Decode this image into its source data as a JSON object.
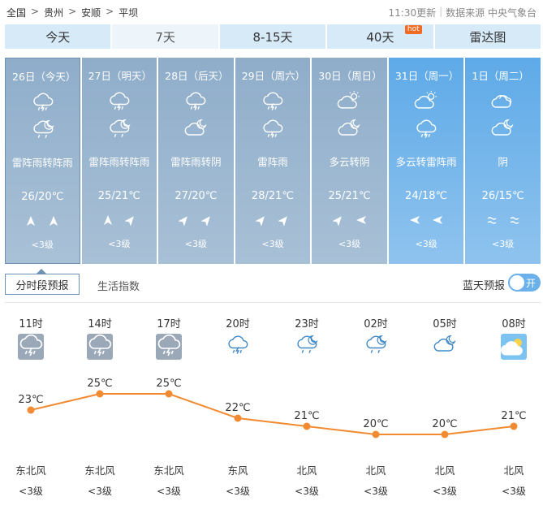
{
  "breadcrumb": [
    "全国",
    "贵州",
    "安顺",
    "平坝"
  ],
  "breadcrumb_sep": ">",
  "meta": {
    "updated": "11:30更新",
    "source": "数据来源 中央气象台"
  },
  "tabs": [
    {
      "label": "今天"
    },
    {
      "label": "7天",
      "active": true
    },
    {
      "label": "8-15天"
    },
    {
      "label": "40天",
      "badge": "hot"
    },
    {
      "label": "雷达图"
    }
  ],
  "days": [
    {
      "date": "26日（今天）",
      "icons": [
        "thunder-shower-icon",
        "shower-night-icon"
      ],
      "cond": "雷阵雨转阵雨",
      "temp": "26/20℃",
      "winds": [
        "north",
        "north"
      ],
      "level": "<3级",
      "style": "today"
    },
    {
      "date": "27日（明天）",
      "icons": [
        "thunder-shower-icon",
        "shower-night-icon"
      ],
      "cond": "雷阵雨转阵雨",
      "temp": "25/21℃",
      "winds": [
        "north",
        "northeast"
      ],
      "level": "<3级",
      "style": "past"
    },
    {
      "date": "28日（后天）",
      "icons": [
        "thunder-shower-icon",
        "cloudy-night-icon"
      ],
      "cond": "雷阵雨转阴",
      "temp": "27/20℃",
      "winds": [
        "northeast",
        "northeast"
      ],
      "level": "<3级",
      "style": "past"
    },
    {
      "date": "29日（周六）",
      "icons": [
        "thunder-shower-icon",
        "thunder-shower-icon"
      ],
      "cond": "雷阵雨",
      "temp": "28/21℃",
      "winds": [
        "northeast",
        "northeast"
      ],
      "level": "<3级",
      "style": "past"
    },
    {
      "date": "30日（周日）",
      "icons": [
        "partly-cloudy-icon",
        "cloudy-night-icon"
      ],
      "cond": "多云转阴",
      "temp": "25/21℃",
      "winds": [
        "northeast",
        "west"
      ],
      "level": "<3级",
      "style": "past"
    },
    {
      "date": "31日（周一）",
      "icons": [
        "partly-cloudy-icon",
        "thunder-shower-icon"
      ],
      "cond": "多云转雷阵雨",
      "temp": "24/18℃",
      "winds": [
        "west",
        "west"
      ],
      "level": "<3级",
      "style": "future"
    },
    {
      "date": "1日（周二）",
      "icons": [
        "overcast-icon",
        "cloudy-night-icon"
      ],
      "cond": "阴",
      "temp": "26/15℃",
      "winds": [
        "calm",
        "calm"
      ],
      "level": "<3级",
      "style": "future"
    }
  ],
  "subtabs": {
    "hourly": "分时段预报",
    "life": "生活指数",
    "blue_sky": "蓝天预报",
    "toggle": "开"
  },
  "hourly": {
    "times": [
      "11时",
      "14时",
      "17时",
      "20时",
      "23时",
      "02时",
      "05时",
      "08时"
    ],
    "icons": [
      "thunder-shower-box-icon",
      "thunder-shower-box-icon",
      "thunder-shower-box-icon",
      "thunder-shower-icon",
      "shower-night-icon",
      "shower-night-icon",
      "cloudy-night-icon",
      "partly-cloudy-box-icon"
    ],
    "winds": [
      "东北风",
      "东北风",
      "东北风",
      "东风",
      "北风",
      "北风",
      "北风",
      "北风"
    ],
    "levels": [
      "<3级",
      "<3级",
      "<3级",
      "<3级",
      "<3级",
      "<3级",
      "<3级",
      "<3级"
    ]
  },
  "chart_data": {
    "type": "line",
    "x": [
      "11时",
      "14时",
      "17时",
      "20时",
      "23时",
      "02时",
      "05时",
      "08时"
    ],
    "values": [
      23,
      25,
      25,
      22,
      21,
      20,
      20,
      21
    ],
    "labels": [
      "23℃",
      "25℃",
      "25℃",
      "22℃",
      "21℃",
      "20℃",
      "20℃",
      "21℃"
    ],
    "line_color": "#f18a30"
  },
  "colors": {
    "accent": "#5eaae8",
    "past": "#9bb6cf",
    "line": "#f18a30"
  }
}
